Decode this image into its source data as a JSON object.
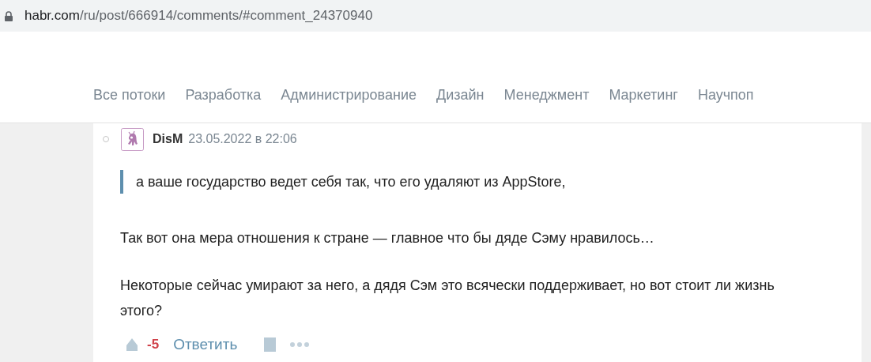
{
  "address_bar": {
    "host": "habr.com",
    "path": "/ru/post/666914/comments/#comment_24370940"
  },
  "nav": [
    {
      "label": "Все потоки"
    },
    {
      "label": "Разработка"
    },
    {
      "label": "Администрирование"
    },
    {
      "label": "Дизайн"
    },
    {
      "label": "Менеджмент"
    },
    {
      "label": "Маркетинг"
    },
    {
      "label": "Научпоп"
    }
  ],
  "comment": {
    "author": "DisM",
    "date": "23.05.2022 в 22:06",
    "quote": "а ваше государство ведет себя так, что его удаляют из AppStore,",
    "paragraphs": [
      "Так вот она мера отношения к стране — главное что бы дяде Сэму нравилось…",
      "Некоторые сейчас умирают за него, а дядя Сэм это всячески поддерживает, но вот стоит ли жизнь этого?"
    ],
    "score": "-5",
    "reply": "Ответить"
  }
}
